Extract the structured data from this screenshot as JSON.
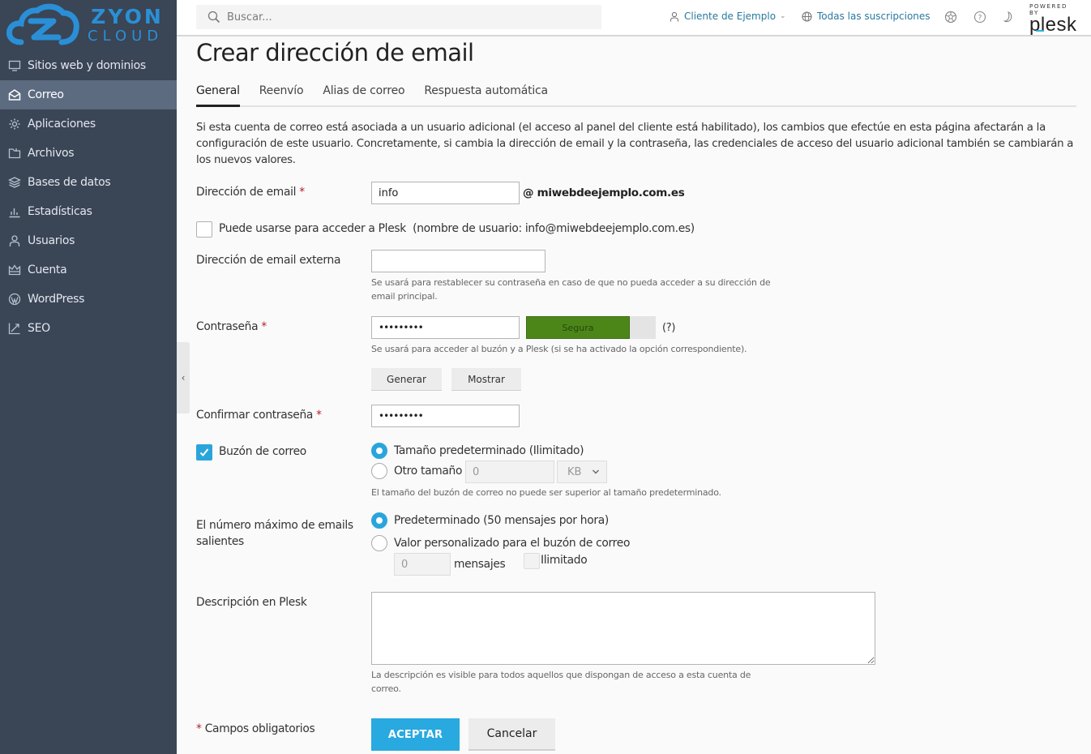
{
  "brand": {
    "line1": "ZYON",
    "line2": "CLOUD",
    "color": "#2a8fd6"
  },
  "sidebar": {
    "items": [
      {
        "label": "Sitios web y dominios",
        "icon": "monitor-icon",
        "active": false
      },
      {
        "label": "Correo",
        "icon": "mail-icon",
        "active": true
      },
      {
        "label": "Aplicaciones",
        "icon": "gear-icon",
        "active": false
      },
      {
        "label": "Archivos",
        "icon": "folder-icon",
        "active": false
      },
      {
        "label": "Bases de datos",
        "icon": "layers-icon",
        "active": false
      },
      {
        "label": "Estadísticas",
        "icon": "bar-chart-icon",
        "active": false
      },
      {
        "label": "Usuarios",
        "icon": "user-icon",
        "active": false
      },
      {
        "label": "Cuenta",
        "icon": "crown-icon",
        "active": false
      },
      {
        "label": "WordPress",
        "icon": "wordpress-icon",
        "active": false
      },
      {
        "label": "SEO",
        "icon": "seo-chart-icon",
        "active": false
      }
    ],
    "collapse_glyph": "‹"
  },
  "header": {
    "search_placeholder": "Buscar...",
    "client_label": "Cliente de Ejemplo",
    "subscriptions_label": "Todas las suscripciones",
    "powered_by": "POWERED BY",
    "plesk": "plesk"
  },
  "page": {
    "title": "Crear dirección de email",
    "tabs": [
      {
        "label": "General",
        "active": true
      },
      {
        "label": "Reenvío",
        "active": false
      },
      {
        "label": "Alias de correo",
        "active": false
      },
      {
        "label": "Respuesta automática",
        "active": false
      }
    ],
    "intro": "Si esta cuenta de correo está asociada a un usuario adicional (el acceso al panel del cliente está habilitado), los cambios que efectúe en esta página afectarán a la configuración de este usuario. Concretamente, si cambia la dirección de email y la contraseña, las credenciales de acceso del usuario adicional también se cambiarán a los nuevos valores."
  },
  "form": {
    "required_mark": "*",
    "email": {
      "label": "Dirección de email",
      "value": "info",
      "domain": "@ miwebdeejemplo.com.es"
    },
    "plesk_access": {
      "label": "Puede usarse para acceder a Plesk",
      "note": "(nombre de usuario: info@miwebdeejemplo.com.es)",
      "checked": false
    },
    "external_email": {
      "label": "Dirección de email externa",
      "value": "",
      "hint": "Se usará para restablecer su contraseña en caso de que no pueda acceder a su dirección de email principal."
    },
    "password": {
      "label": "Contraseña",
      "value": "•••••••••",
      "strength": "Segura",
      "strength_fraction": 0.8,
      "strength_color": "#4c8619",
      "help": "(?)",
      "hint": "Se usará para acceder al buzón y a Plesk (si se ha activado la opción correspondiente).",
      "generate": "Generar",
      "show": "Mostrar"
    },
    "confirm_password": {
      "label": "Confirmar contraseña",
      "value": "•••••••••"
    },
    "mailbox": {
      "label": "Buzón de correo",
      "checked": true,
      "default_size": "Tamaño predeterminado (Ilimitado)",
      "other_size": "Otro tamaño",
      "other_value": "0",
      "unit": "KB",
      "selected": "default",
      "hint": "El tamaño del buzón de correo no puede ser superior al tamaño predeterminado."
    },
    "outgoing": {
      "label": "El número máximo de emails salientes",
      "default": "Predeterminado (50 mensajes por hora)",
      "custom": "Valor personalizado para el buzón de correo",
      "custom_value": "0",
      "messages": "mensajes",
      "unlimited": "Ilimitado",
      "selected": "default"
    },
    "description": {
      "label": "Descripción en Plesk",
      "value": "",
      "hint": "La descripción es visible para todos aquellos que dispongan de acceso a esta cuenta de correo."
    },
    "required_note": "Campos obligatorios",
    "ok": "ACEPTAR",
    "cancel": "Cancelar",
    "accent": "#28a9df"
  }
}
